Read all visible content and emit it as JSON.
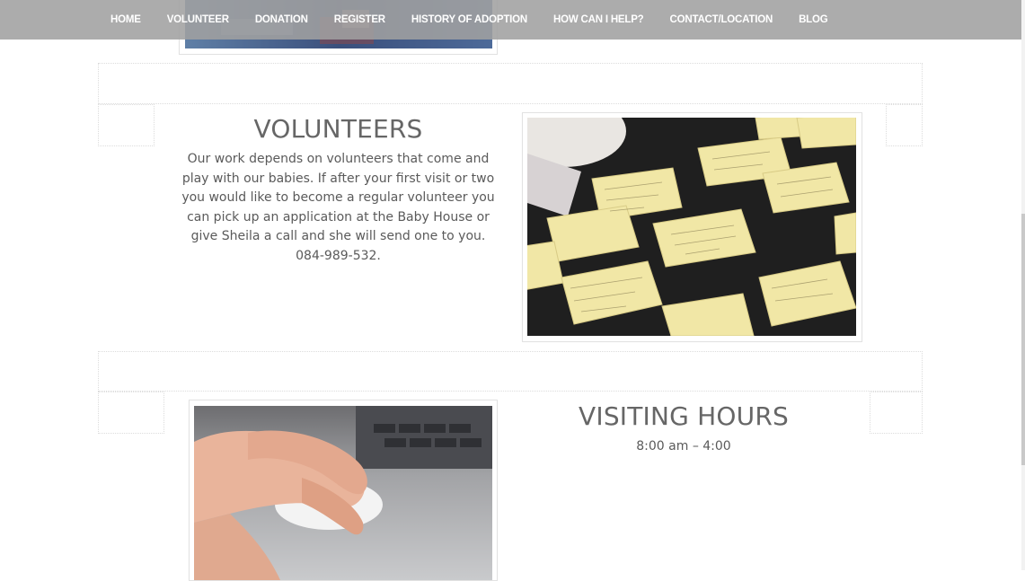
{
  "nav": {
    "items": [
      {
        "label": "HOME"
      },
      {
        "label": "VOLUNTEER"
      },
      {
        "label": "DONATION"
      },
      {
        "label": "REGISTER"
      },
      {
        "label": "HISTORY OF ADOPTION"
      },
      {
        "label": "HOW CAN I HELP?"
      },
      {
        "label": "CONTACT/LOCATION"
      },
      {
        "label": "BLOG"
      }
    ]
  },
  "volunteers": {
    "title": "VOLUNTEERS",
    "body": "Our work depends on volunteers that come and play with our babies.  If after your first visit or two you would like to become a regular volunteer you can pick up an application at the Baby House or give Sheila a call and she will send one to you.  084-989-532."
  },
  "visiting": {
    "title": "VISITING HOURS",
    "hours": "8:00 am – 4:00"
  },
  "colors": {
    "nav_bg": "#a0a0a0",
    "heading": "#666666",
    "text": "#5a5a5a"
  }
}
